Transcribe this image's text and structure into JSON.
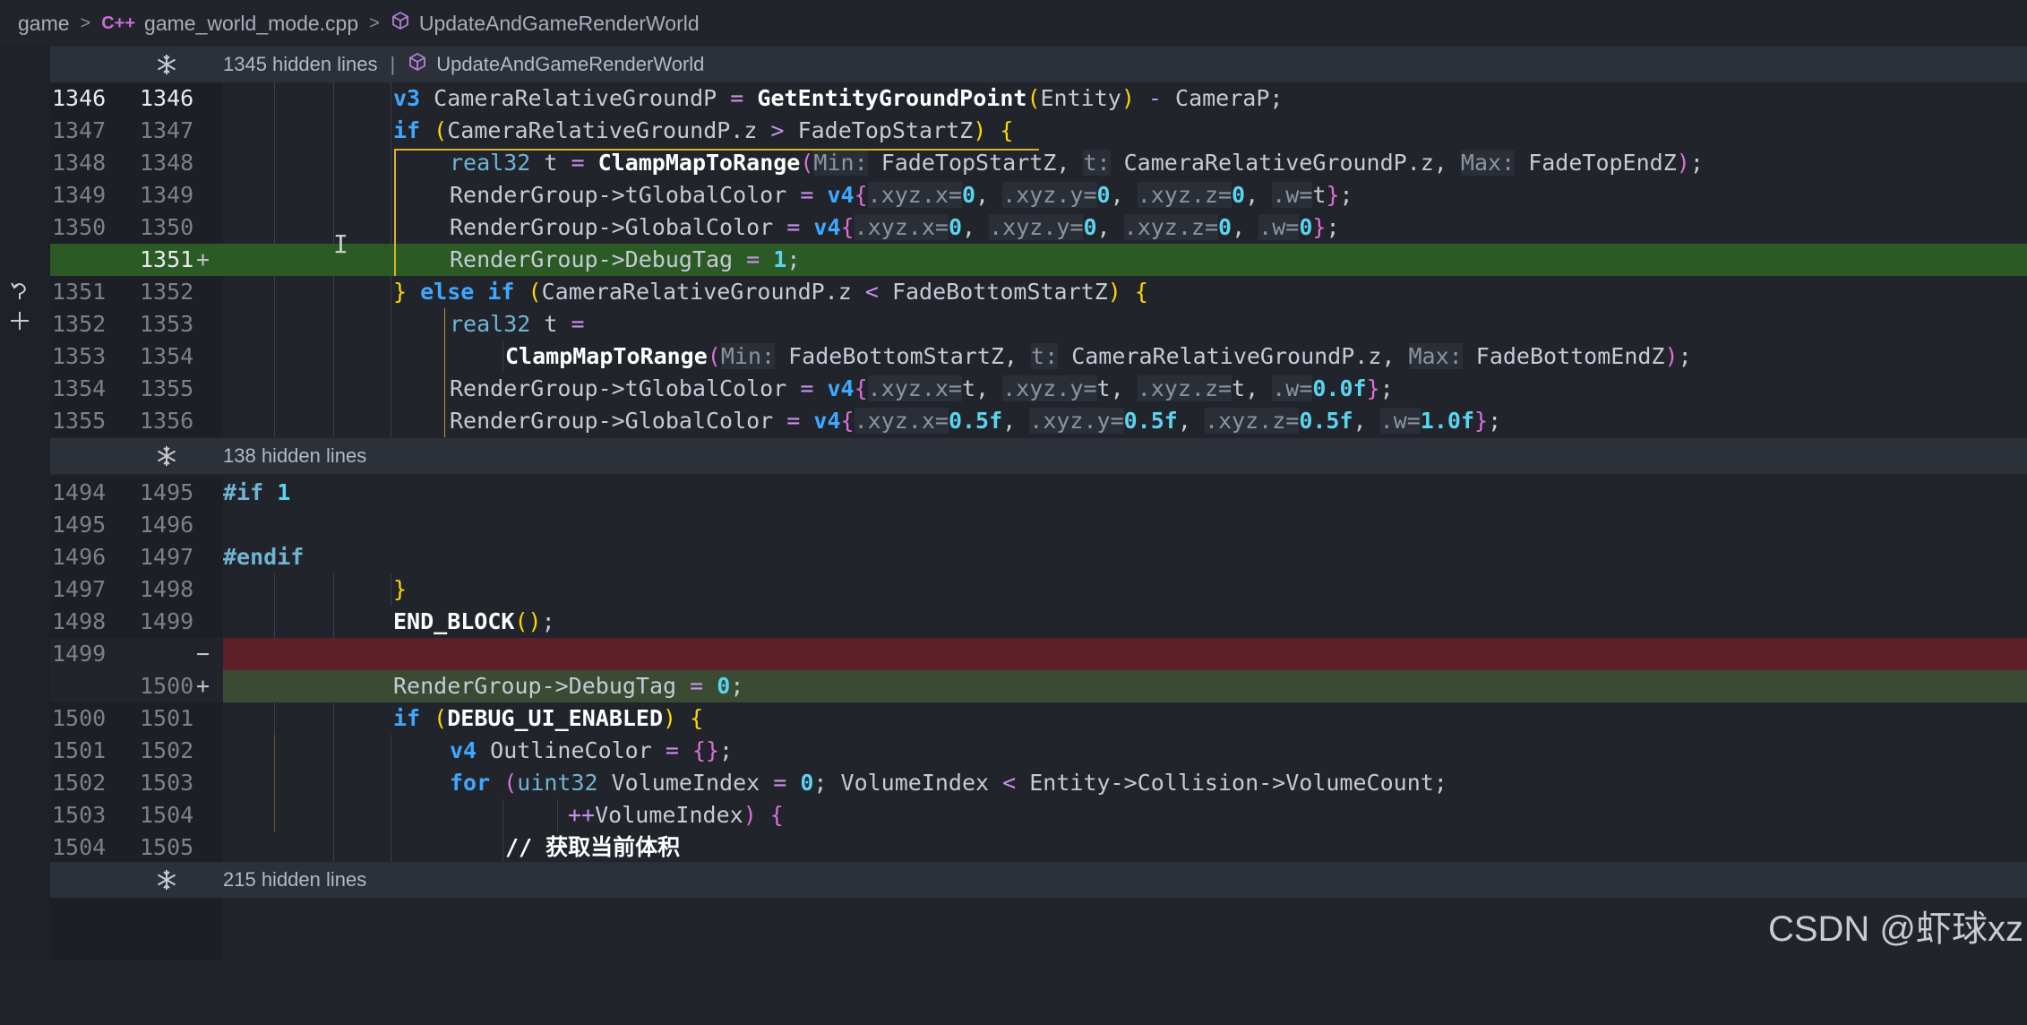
{
  "breadcrumb": {
    "folder": "game",
    "file_icon": "C++",
    "file": "game_world_mode.cpp",
    "symbol": "UpdateAndGameRenderWorld"
  },
  "hidden_bars": [
    {
      "text": "1345 hidden lines",
      "separator": "|",
      "symbol": "UpdateAndGameRenderWorld"
    },
    {
      "text": "138 hidden lines"
    },
    {
      "text": "215 hidden lines"
    }
  ],
  "gutter_icons": [
    "revert-icon",
    "add-icon"
  ],
  "lines": [
    {
      "old": "1346",
      "new": "1346",
      "mark": "",
      "state": "current"
    },
    {
      "old": "1347",
      "new": "1347",
      "mark": ""
    },
    {
      "old": "1348",
      "new": "1348",
      "mark": ""
    },
    {
      "old": "1349",
      "new": "1349",
      "mark": ""
    },
    {
      "old": "1350",
      "new": "1350",
      "mark": ""
    },
    {
      "old": "",
      "new": "1351",
      "mark": "+",
      "state": "added"
    },
    {
      "old": "1351",
      "new": "1352",
      "mark": ""
    },
    {
      "old": "1352",
      "new": "1353",
      "mark": ""
    },
    {
      "old": "1353",
      "new": "1354",
      "mark": ""
    },
    {
      "old": "1354",
      "new": "1355",
      "mark": ""
    },
    {
      "old": "1355",
      "new": "1356",
      "mark": ""
    },
    {
      "old": "1494",
      "new": "1495",
      "mark": ""
    },
    {
      "old": "1495",
      "new": "1496",
      "mark": ""
    },
    {
      "old": "1496",
      "new": "1497",
      "mark": ""
    },
    {
      "old": "1497",
      "new": "1498",
      "mark": ""
    },
    {
      "old": "1498",
      "new": "1499",
      "mark": ""
    },
    {
      "old": "1499",
      "new": "",
      "mark": "−",
      "state": "removed"
    },
    {
      "old": "",
      "new": "1500",
      "mark": "+",
      "state": "added"
    },
    {
      "old": "1500",
      "new": "1501",
      "mark": ""
    },
    {
      "old": "1501",
      "new": "1502",
      "mark": ""
    },
    {
      "old": "1502",
      "new": "1503",
      "mark": ""
    },
    {
      "old": "1503",
      "new": "1504",
      "mark": ""
    },
    {
      "old": "1504",
      "new": "1505",
      "mark": ""
    }
  ],
  "code": {
    "l1346": {
      "kw": "v3",
      "var": " CameraRelativeGroundP ",
      "eq": "=",
      "fn": " GetEntityGroundPoint",
      "p1": "(",
      "arg": "Entity",
      "p2": ")",
      "minus": " - ",
      "rest": "CameraP;"
    },
    "l1347": {
      "kw": "if",
      "p1": " (",
      "lhs": "CameraRelativeGroundP.z ",
      "op": ">",
      "rhs": " FadeTopStartZ",
      "p2": ")",
      "brace": " {"
    },
    "l1348": {
      "type": "real32",
      "var": " t ",
      "eq": "=",
      "fn": " ClampMapToRange",
      "p1": "(",
      "h1": "Min:",
      "a1": " FadeTopStartZ, ",
      "h2": "t:",
      "a2": " CameraRelativeGroundP.z, ",
      "h3": "Max:",
      "a3": " FadeTopEndZ",
      "p2": ")",
      "end": ";"
    },
    "l1349": {
      "lhs": "RenderGroup->tGlobalColor ",
      "eq": "=",
      "kw": " v4",
      "b": "{",
      "h1": ".xyz.x=",
      "v1": "0",
      "c1": ", ",
      "h2": ".xyz.y=",
      "v2": "0",
      "c2": ", ",
      "h3": ".xyz.z=",
      "v3": "0",
      "c3": ", ",
      "h4": ".w=",
      "v4": "t",
      "bc": "}",
      "end": ";"
    },
    "l1350": {
      "lhs": "RenderGroup->GlobalColor ",
      "eq": "=",
      "kw": " v4",
      "b": "{",
      "h1": ".xyz.x=",
      "v1": "0",
      "c1": ", ",
      "h2": ".xyz.y=",
      "v2": "0",
      "c2": ", ",
      "h3": ".xyz.z=",
      "v3": "0",
      "c3": ", ",
      "h4": ".w=",
      "v4": "0",
      "bc": "}",
      "end": ";"
    },
    "l1351": {
      "lhs": "RenderGroup->DebugTag ",
      "eq": "=",
      "num": " 1",
      "end": ";"
    },
    "l1352": {
      "brace": "}",
      "kw": " else if",
      "p1": " (",
      "lhs": "CameraRelativeGroundP.z ",
      "op": "<",
      "rhs": " FadeBottomStartZ",
      "p2": ")",
      "brace2": " {"
    },
    "l1353": {
      "type": "real32",
      "var": " t ",
      "eq": "="
    },
    "l1354": {
      "fn": "ClampMapToRange",
      "p1": "(",
      "h1": "Min:",
      "a1": " FadeBottomStartZ, ",
      "h2": "t:",
      "a2": " CameraRelativeGroundP.z, ",
      "h3": "Max:",
      "a3": " FadeBottomEndZ",
      "p2": ")",
      "end": ";"
    },
    "l1355": {
      "lhs": "RenderGroup->tGlobalColor ",
      "eq": "=",
      "kw": " v4",
      "b": "{",
      "h1": ".xyz.x=",
      "v1": "t",
      "c1": ", ",
      "h2": ".xyz.y=",
      "v2": "t",
      "c2": ", ",
      "h3": ".xyz.z=",
      "v3": "t",
      "c3": ", ",
      "h4": ".w=",
      "v4": "0.0f",
      "bc": "}",
      "end": ";"
    },
    "l1356": {
      "lhs": "RenderGroup->GlobalColor ",
      "eq": "=",
      "kw": " v4",
      "b": "{",
      "h1": ".xyz.x=",
      "v1": "0.5f",
      "c1": ", ",
      "h2": ".xyz.y=",
      "v2": "0.5f",
      "c2": ", ",
      "h3": ".xyz.z=",
      "v3": "0.5f",
      "c3": ", ",
      "h4": ".w=",
      "v4": "1.0f",
      "bc": "}",
      "end": ";"
    },
    "l1495": {
      "pp": "#if",
      "num": " 1"
    },
    "l1497": {
      "pp": "#endif"
    },
    "l1498": {
      "brace": "}"
    },
    "l1499": {
      "fn": "END_BLOCK",
      "p": "()",
      "end": ";"
    },
    "l1500": {
      "lhs": "RenderGroup->DebugTag ",
      "eq": "=",
      "num": " 0",
      "end": ";"
    },
    "l1501": {
      "kw": "if",
      "p1": " (",
      "fn": "DEBUG_UI_ENABLED",
      "p2": ")",
      "brace": " {"
    },
    "l1502": {
      "kw": "v4",
      "var": " OutlineColor ",
      "eq": "=",
      "b": " {}",
      "end": ";"
    },
    "l1503": {
      "kw": "for",
      "p1": " (",
      "type": "uint32",
      "var": " VolumeIndex ",
      "eq": "=",
      "num": " 0",
      "rest1": "; VolumeIndex ",
      "op": "<",
      "rest2": " Entity->Collision->VolumeCount;"
    },
    "l1504": {
      "op": "++",
      "var": "VolumeIndex",
      "p2": ")",
      "brace": " {"
    },
    "l1505": {
      "cm": "// 获取当前体积"
    }
  },
  "watermark": "CSDN @虾球xz"
}
